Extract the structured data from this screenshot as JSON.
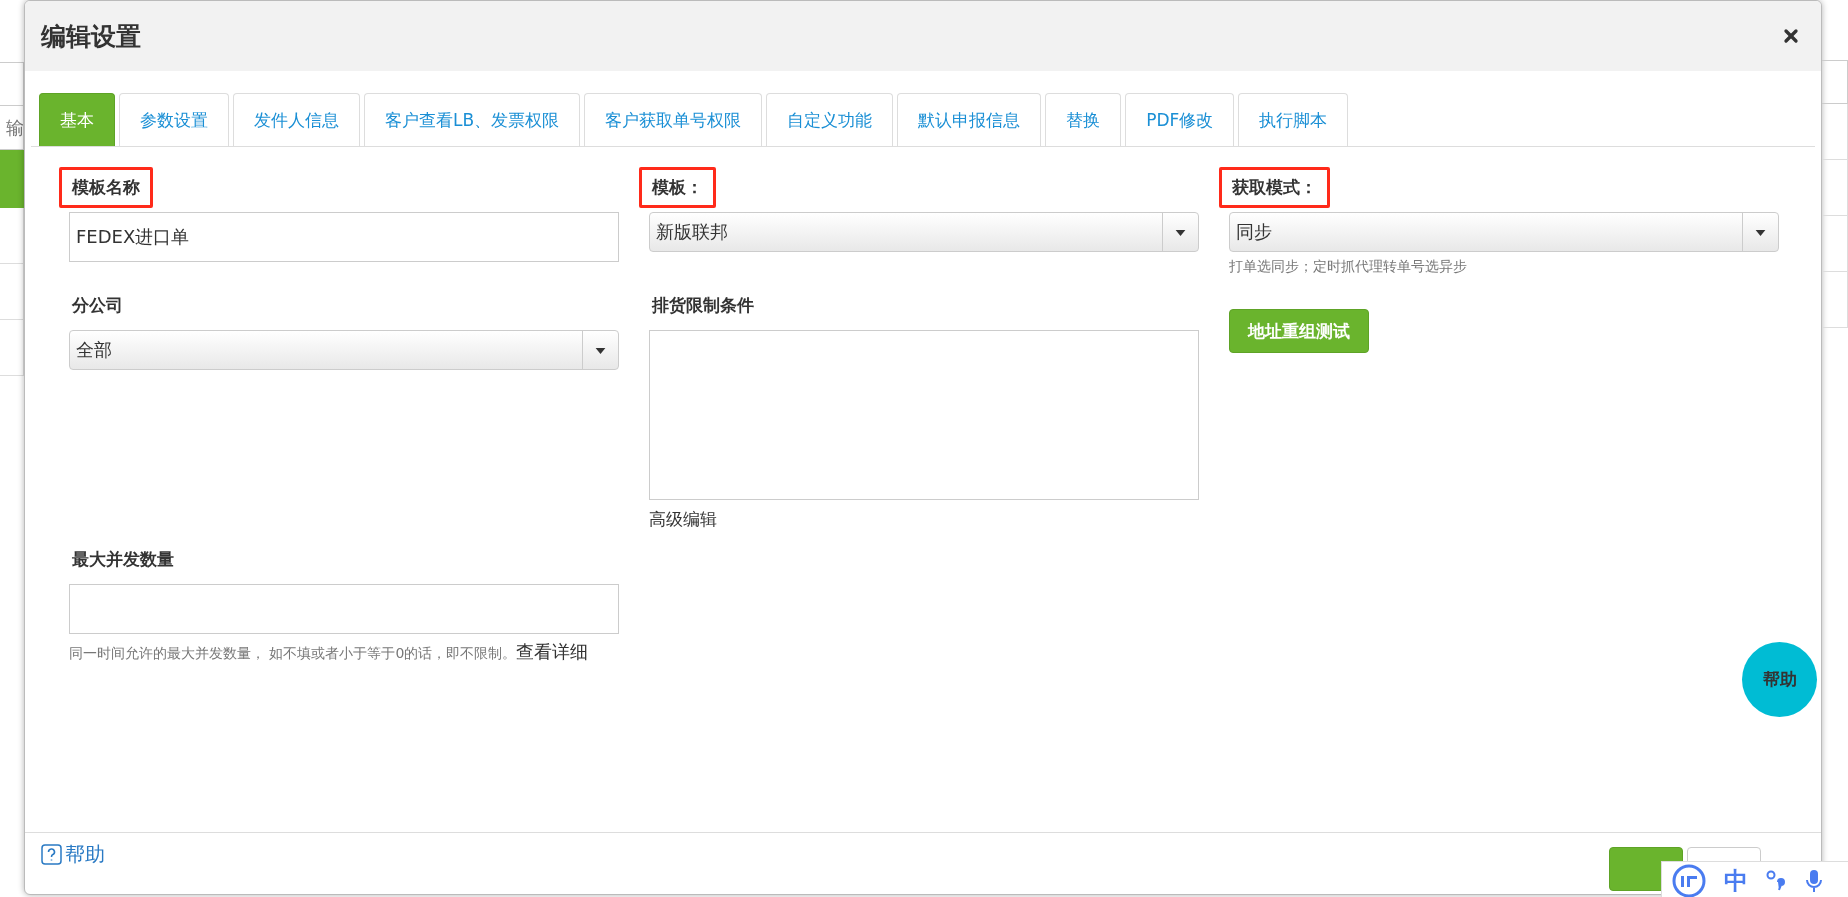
{
  "background": {
    "input_text": "输"
  },
  "dialog": {
    "title": "编辑设置"
  },
  "tabs": [
    {
      "label": "基本",
      "selected": true
    },
    {
      "label": "参数设置",
      "selected": false
    },
    {
      "label": "发件人信息",
      "selected": false
    },
    {
      "label": "客户查看LB、发票权限",
      "selected": false
    },
    {
      "label": "客户获取单号权限",
      "selected": false
    },
    {
      "label": "自定义功能",
      "selected": false
    },
    {
      "label": "默认申报信息",
      "selected": false
    },
    {
      "label": "替换",
      "selected": false
    },
    {
      "label": "PDF修改",
      "selected": false
    },
    {
      "label": "执行脚本",
      "selected": false
    }
  ],
  "fields": [
    {
      "kind": "text",
      "label": "模板名称",
      "highlighted": true,
      "value": "FEDEX进口单"
    },
    {
      "kind": "select",
      "label": "模板：",
      "highlighted": true,
      "value": "新版联邦"
    },
    {
      "kind": "select",
      "label": "获取模式：",
      "highlighted": true,
      "value": "同步",
      "hint": "打单选同步；定时抓代理转单号选异步"
    },
    {
      "kind": "select",
      "label": "分公司",
      "highlighted": false,
      "value": "全部"
    },
    {
      "kind": "textarea",
      "label": "排货限制条件",
      "highlighted": false,
      "link": "高级编辑"
    },
    {
      "kind": "button",
      "label": "地址重组测试"
    },
    {
      "kind": "text",
      "label": "最大并发数量",
      "highlighted": false,
      "hint": "同一时间允许的最大并发数量， 如不填或者小于等于0的话，即不限制。",
      "hint_link": "查看详细"
    }
  ],
  "footer": {
    "help": "帮助"
  },
  "floating_help": "帮助",
  "ime_toolbar": {
    "mode": "中"
  }
}
